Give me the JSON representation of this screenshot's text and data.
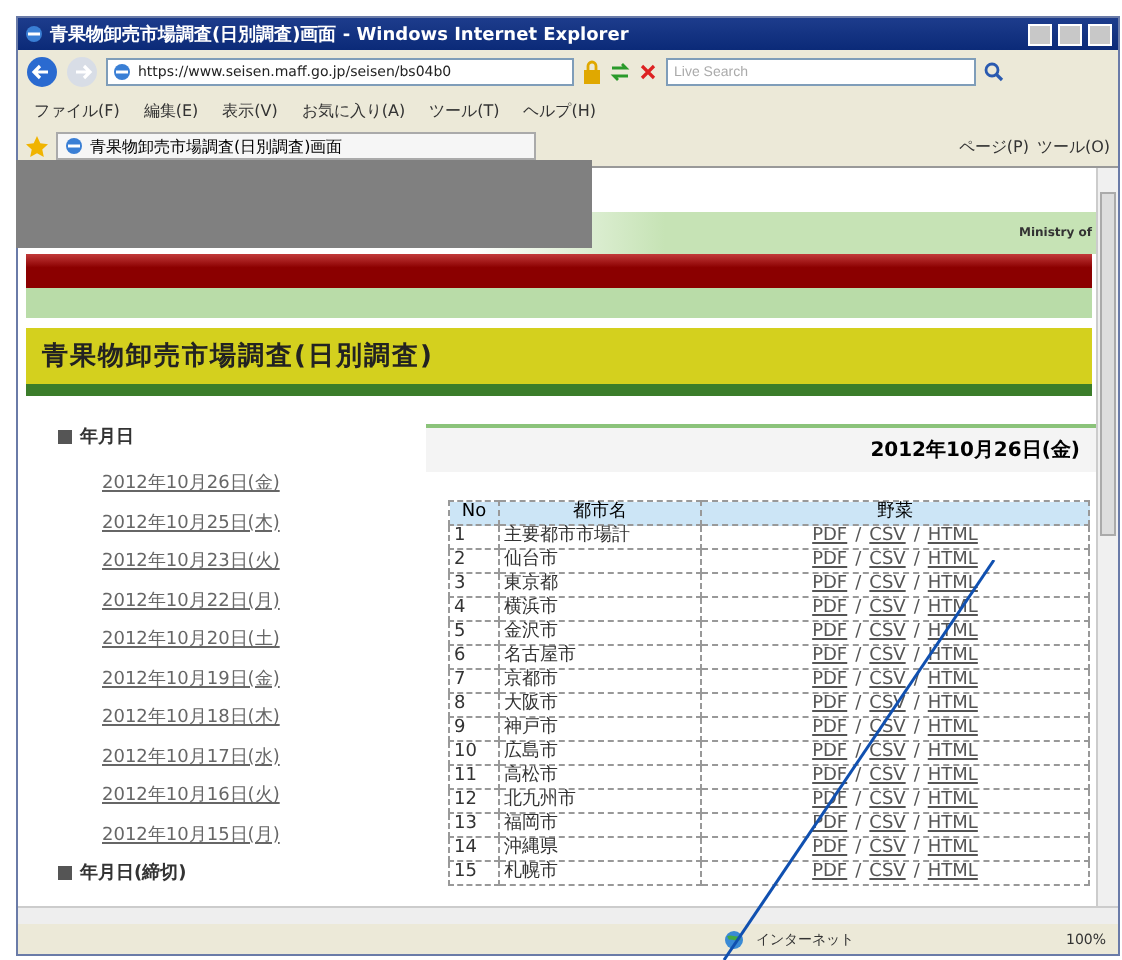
{
  "window": {
    "title": "青果物卸売市場調査(日別調査)画面 - Windows Internet Explorer"
  },
  "address_bar": {
    "url": "https://www.seisen.maff.go.jp/seisen/bs04b0"
  },
  "search": {
    "placeholder": "Live Search"
  },
  "menu": [
    "ファイル(F)",
    "編集(E)",
    "表示(V)",
    "お気に入り(A)",
    "ツール(T)",
    "ヘルプ(H)"
  ],
  "tab": {
    "title": "青果物卸売市場調査(日別調査)画面"
  },
  "command_bar": [
    "ページ(P)",
    "ツール(O)"
  ],
  "page": {
    "ministry": "Ministry of",
    "heading": "青果物卸売市場調査(日別調査)",
    "sidebar": {
      "heading": "年月日",
      "dates": [
        "2012年10月26日(金)",
        "2012年10月25日(木)",
        "2012年10月23日(火)",
        "2012年10月22日(月)",
        "2012年10月20日(土)",
        "2012年10月19日(金)",
        "2012年10月18日(木)",
        "2012年10月17日(水)",
        "2012年10月16日(火)",
        "2012年10月15日(月)"
      ],
      "heading_2": "年月日(締切)"
    },
    "date_title": "2012年10月26日(金)",
    "table": {
      "columns": [
        "No",
        "都市名",
        "野菜"
      ],
      "link_separator": "/",
      "rows": [
        {
          "no": "1",
          "city": "主要都市市場計",
          "links": [
            "PDF",
            "CSV",
            "HTML"
          ]
        },
        {
          "no": "2",
          "city": "仙台市",
          "links": [
            "PDF",
            "CSV",
            "HTML"
          ]
        },
        {
          "no": "3",
          "city": "東京都",
          "links": [
            "PDF",
            "CSV",
            "HTML"
          ]
        },
        {
          "no": "4",
          "city": "横浜市",
          "links": [
            "PDF",
            "CSV",
            "HTML"
          ]
        },
        {
          "no": "5",
          "city": "金沢市",
          "links": [
            "PDF",
            "CSV",
            "HTML"
          ]
        },
        {
          "no": "6",
          "city": "名古屋市",
          "links": [
            "PDF",
            "CSV",
            "HTML"
          ]
        },
        {
          "no": "7",
          "city": "京都市",
          "links": [
            "PDF",
            "CSV",
            "HTML"
          ]
        },
        {
          "no": "8",
          "city": "大阪市",
          "links": [
            "PDF",
            "CSV",
            "HTML"
          ]
        },
        {
          "no": "9",
          "city": "神戸市",
          "links": [
            "PDF",
            "CSV",
            "HTML"
          ]
        },
        {
          "no": "10",
          "city": "広島市",
          "links": [
            "PDF",
            "CSV",
            "HTML"
          ]
        },
        {
          "no": "11",
          "city": "高松市",
          "links": [
            "PDF",
            "CSV",
            "HTML"
          ]
        },
        {
          "no": "12",
          "city": "北九州市",
          "links": [
            "PDF",
            "CSV",
            "HTML"
          ]
        },
        {
          "no": "13",
          "city": "福岡市",
          "links": [
            "PDF",
            "CSV",
            "HTML"
          ]
        },
        {
          "no": "14",
          "city": "沖縄県",
          "links": [
            "PDF",
            "CSV",
            "HTML"
          ]
        },
        {
          "no": "15",
          "city": "札幌市",
          "links": [
            "PDF",
            "CSV",
            "HTML"
          ]
        }
      ]
    }
  },
  "status_bar": {
    "zone": "インターネット",
    "zoom": "100%"
  }
}
